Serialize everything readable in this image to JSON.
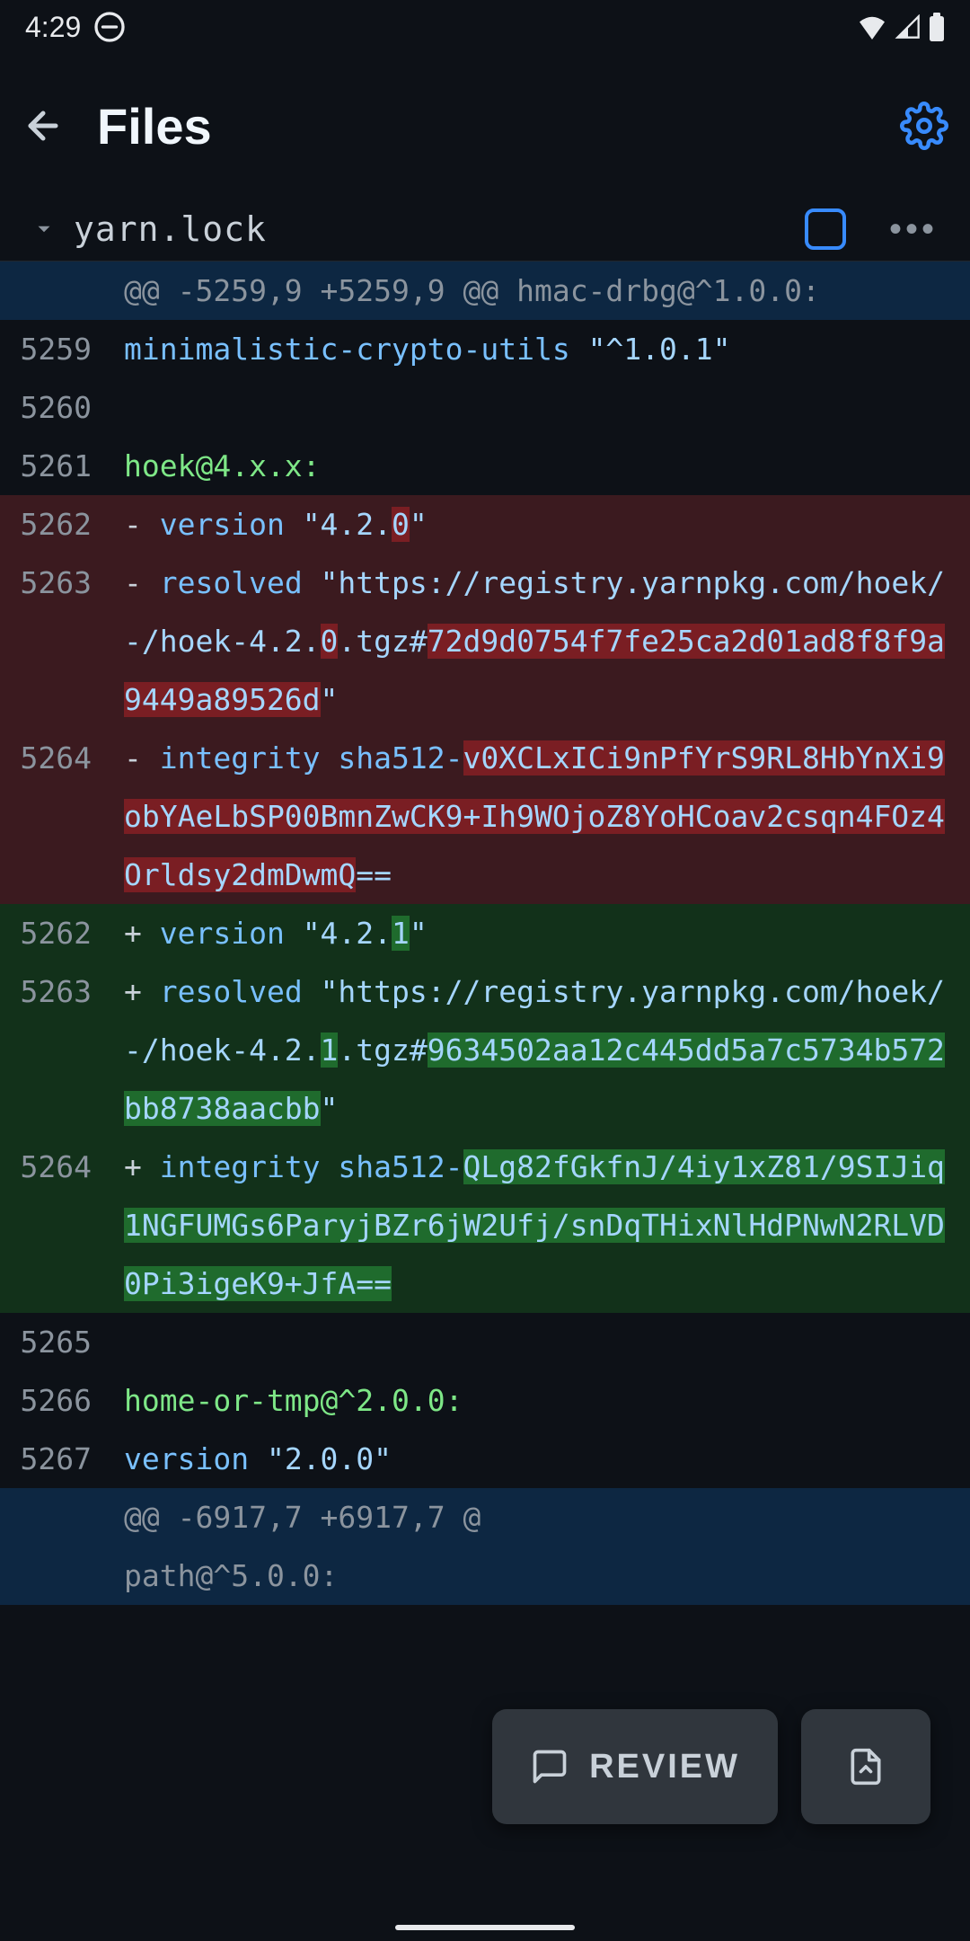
{
  "status": {
    "time": "4:29"
  },
  "app": {
    "title": "Files"
  },
  "file": {
    "name": "yarn.lock"
  },
  "hunk1": "@@ -5259,9 +5259,9 @@ hmac-drbg@^1.0.0:",
  "hunk2a": "@@ -6917,7 +6917,7 @",
  "hunk2b": "path@^5.0.0:",
  "lines": {
    "l5259": {
      "num": "5259",
      "a": "minimalistic-crypto-utils ",
      "b": "\"^1.0.1\""
    },
    "l5260": {
      "num": "5260"
    },
    "l5261": {
      "num": "5261",
      "text": "hoek@4.x.x:"
    },
    "d5262": {
      "num": "5262",
      "sign": "-",
      "a": "  version ",
      "b": "\"4.2.",
      "hi": "0",
      "c": "\""
    },
    "d5263": {
      "num": "5263",
      "sign": "-",
      "a": "  resolved ",
      "b": "\"https://registry.yarnpkg.com/hoek/-/hoek-4.2.",
      "hi1": "0",
      "c": ".tgz#",
      "hi2": "72d9d0754f7fe25ca2d01ad8f8f9a9449a89526d",
      "d": "\""
    },
    "d5264": {
      "num": "5264",
      "sign": "-",
      "a": "  integrity sha512-",
      "hi": "v0XCLxICi9nPfYrS9RL8HbYnXi9obYAeLbSP00BmnZwCK9+Ih9WOjoZ8YoHCoav2csqn4FOz4Orldsy2dmDwmQ",
      "b": "=="
    },
    "a5262": {
      "num": "5262",
      "sign": "+",
      "a": "  version ",
      "b": "\"4.2.",
      "hi": "1",
      "c": "\""
    },
    "a5263": {
      "num": "5263",
      "sign": "+",
      "a": "  resolved ",
      "b": "\"https://registry.yarnpkg.com/hoek/-/hoek-4.2.",
      "hi1": "1",
      "c": ".tgz#",
      "hi2": "9634502aa12c445dd5a7c5734b572bb8738aacbb",
      "d": "\""
    },
    "a5264": {
      "num": "5264",
      "sign": "+",
      "a": "  integrity sha512-",
      "hi": "QLg82fGkfnJ/4iy1xZ81/9SIJiq1NGFUMGs6ParyjBZr6jW2Ufj/snDqTHixNlHdPNwN2RLVD0Pi3igeK9+JfA=="
    },
    "l5265": {
      "num": "5265"
    },
    "l5266": {
      "num": "5266",
      "text": "home-or-tmp@^2.0.0:"
    },
    "l5267": {
      "num": "5267",
      "a": "version ",
      "b": "\"2.0.0\""
    }
  },
  "review": "REVIEW"
}
